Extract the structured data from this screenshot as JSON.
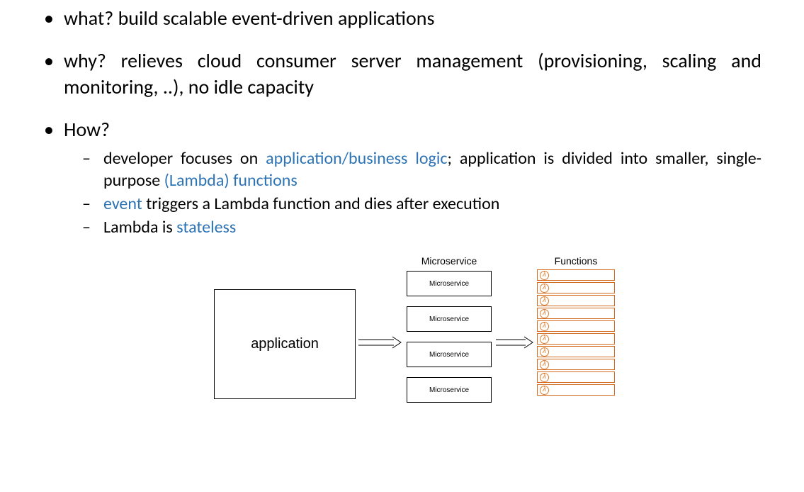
{
  "bullets": {
    "b1": "what? build scalable event-driven applications",
    "b2": "why? relieves cloud consumer server management (provisioning, scaling and monitoring, ..), no idle capacity",
    "b3_lead": "How?",
    "b3_1_pre": "developer focuses on ",
    "b3_1_hl1": "application/business logic",
    "b3_1_mid": "; application is divided into smaller, single-purpose ",
    "b3_1_hl2": "(Lambda) functions",
    "b3_2_hl": "event",
    "b3_2_rest": " triggers a Lambda function and dies after execution",
    "b3_3_pre": "Lambda is ",
    "b3_3_hl": "stateless"
  },
  "diagram": {
    "app_label": "application",
    "microservice_heading": "Microservice",
    "microservice_box_label": "Microservice",
    "functions_heading": "Functions",
    "microservice_count": 4,
    "function_count": 10,
    "lambda_glyph": "λ"
  }
}
